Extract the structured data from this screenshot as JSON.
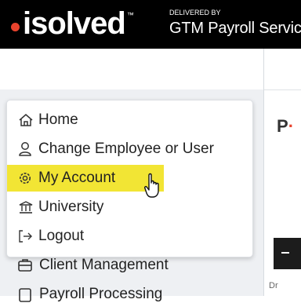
{
  "header": {
    "logo_text": "isolved",
    "logo_trademark": "™",
    "delivered_by": "DELIVERED BY",
    "provider": "GTM Payroll Servic"
  },
  "user_menu": {
    "items": [
      {
        "label": "Home",
        "icon": "home-icon"
      },
      {
        "label": "Change Employee or User",
        "icon": "user-outline-icon"
      },
      {
        "label": "My Account",
        "icon": "gear-icon",
        "highlighted": true
      },
      {
        "label": "University",
        "icon": "bank-icon"
      },
      {
        "label": "Logout",
        "icon": "logout-icon"
      }
    ]
  },
  "sidebar": {
    "items": [
      {
        "label": "Client Management",
        "icon": "client-management-icon"
      },
      {
        "label": "Payroll Processing",
        "icon": "payroll-icon"
      }
    ]
  },
  "main": {
    "title_first": "P",
    "title_accent": "·",
    "card_sub": "Dr"
  },
  "colors": {
    "highlight": "#f2e534",
    "brand_accent": "#e8432d",
    "user_icon": "#1a6fb5",
    "pin_icon": "#1a6fb5"
  }
}
